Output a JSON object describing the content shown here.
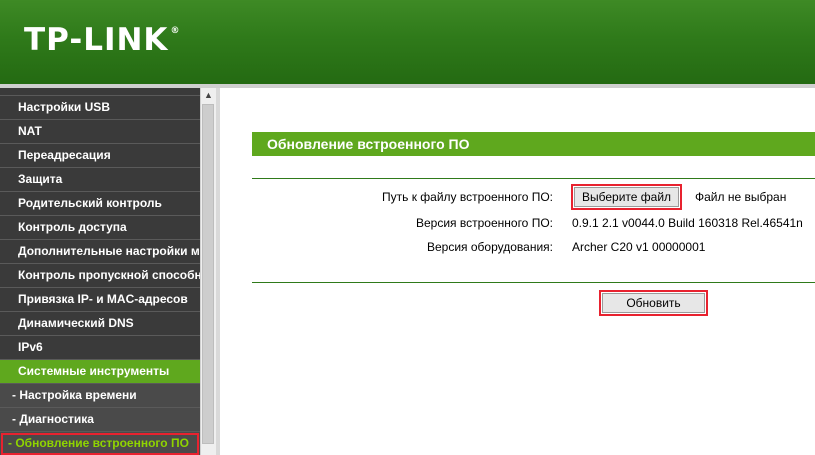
{
  "brand": {
    "logo_text": "TP-LINK",
    "registered_mark": "®",
    "accent_color": "#5fa81e",
    "header_color": "#2f7a1a"
  },
  "sidebar": {
    "items": [
      {
        "label": "Настройки USB",
        "state": "normal"
      },
      {
        "label": "NAT",
        "state": "normal"
      },
      {
        "label": "Переадресация",
        "state": "normal"
      },
      {
        "label": "Защита",
        "state": "normal"
      },
      {
        "label": "Родительский контроль",
        "state": "normal"
      },
      {
        "label": "Контроль доступа",
        "state": "normal"
      },
      {
        "label": "Дополнительные настройки м",
        "state": "normal"
      },
      {
        "label": "Контроль пропускной способн",
        "state": "normal"
      },
      {
        "label": "Привязка IP- и MAC-адресов",
        "state": "normal"
      },
      {
        "label": "Динамический DNS",
        "state": "normal"
      },
      {
        "label": "IPv6",
        "state": "normal"
      },
      {
        "label": "Системные инструменты",
        "state": "active"
      },
      {
        "label": "- Настройка времени",
        "state": "sub"
      },
      {
        "label": "- Диагностика",
        "state": "sub"
      },
      {
        "label": "- Обновление встроенного ПО",
        "state": "sub-selected"
      }
    ]
  },
  "scrollbar": {
    "up_arrow": "▲"
  },
  "main": {
    "title": "Обновление встроенного ПО",
    "firmware_path_label": "Путь к файлу встроенного ПО:",
    "choose_file_label": "Выберите файл",
    "file_status": "Файл не выбран",
    "firmware_version_label": "Версия встроенного ПО:",
    "firmware_version_value": "0.9.1 2.1 v0044.0 Build 160318 Rel.46541n",
    "hardware_version_label": "Версия оборудования:",
    "hardware_version_value": "Archer C20 v1 00000001",
    "upgrade_button_label": "Обновить"
  }
}
